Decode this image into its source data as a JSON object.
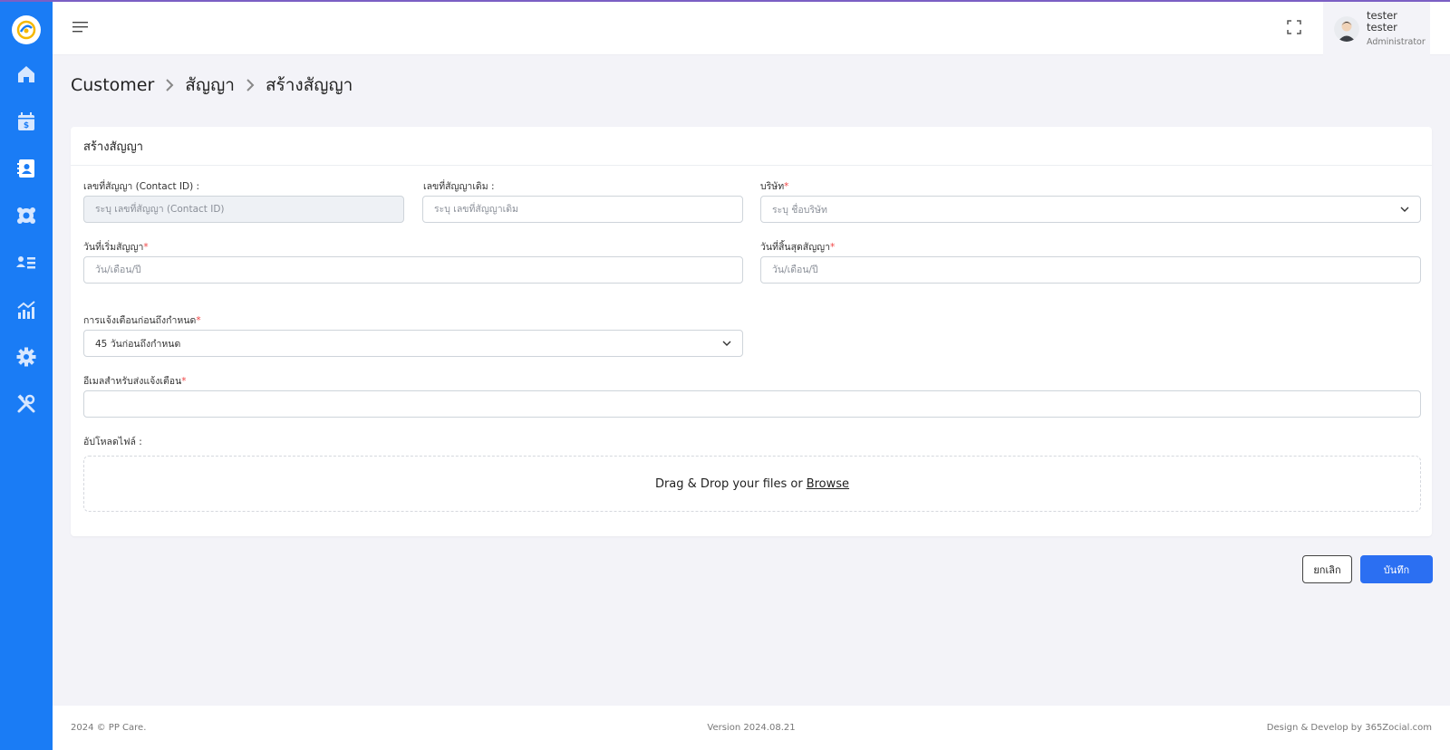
{
  "app": {
    "accent_color": "#1a7cf5",
    "primary_button_color": "#2b6ff2"
  },
  "sidebar": {
    "items": [
      {
        "icon": "home-icon"
      },
      {
        "icon": "calendar-billing-icon"
      },
      {
        "icon": "contact-book-icon"
      },
      {
        "icon": "team-gear-icon"
      },
      {
        "icon": "user-list-icon"
      },
      {
        "icon": "chart-icon"
      },
      {
        "icon": "settings-icon"
      },
      {
        "icon": "tools-icon"
      }
    ]
  },
  "header": {
    "user_name": "tester tester",
    "user_role": "Administrator"
  },
  "breadcrumb": {
    "items": [
      "Customer",
      "สัญญา",
      "สร้างสัญญา"
    ]
  },
  "form": {
    "title": "สร้างสัญญา",
    "contract_id": {
      "label": "เลขที่สัญญา (Contact ID) :",
      "placeholder": "ระบุ เลขที่สัญญา (Contact ID)"
    },
    "old_contract": {
      "label": "เลขที่สัญญาเดิม :",
      "placeholder": "ระบุ เลขที่สัญญาเดิม"
    },
    "company": {
      "label": "บริษัท",
      "placeholder": "ระบุ ชื่อบริษัท"
    },
    "start_date": {
      "label": "วันที่เริ่มสัญญา",
      "placeholder": "วัน/เดือน/ปี"
    },
    "end_date": {
      "label": "วันที่สิ้นสุดสัญญา",
      "placeholder": "วัน/เดือน/ปี"
    },
    "reminder": {
      "label": "การแจ้งเตือนก่อนถึงกำหนด",
      "value": "45 วันก่อนถึงกำหนด"
    },
    "email": {
      "label": "อีเมลสำหรับส่งแจ้งเตือน",
      "value": ""
    },
    "upload": {
      "label": "อัปโหลดไฟล์ :",
      "drop_text": "Drag & Drop your files or",
      "browse_text": "Browse"
    },
    "required_mark": "*"
  },
  "actions": {
    "cancel_label": "ยกเลิก",
    "save_label": "บันทึก"
  },
  "footer": {
    "copyright": "2024 © PP Care.",
    "version": "Version 2024.08.21",
    "credit": "Design & Develop by 365Zocial.com"
  }
}
